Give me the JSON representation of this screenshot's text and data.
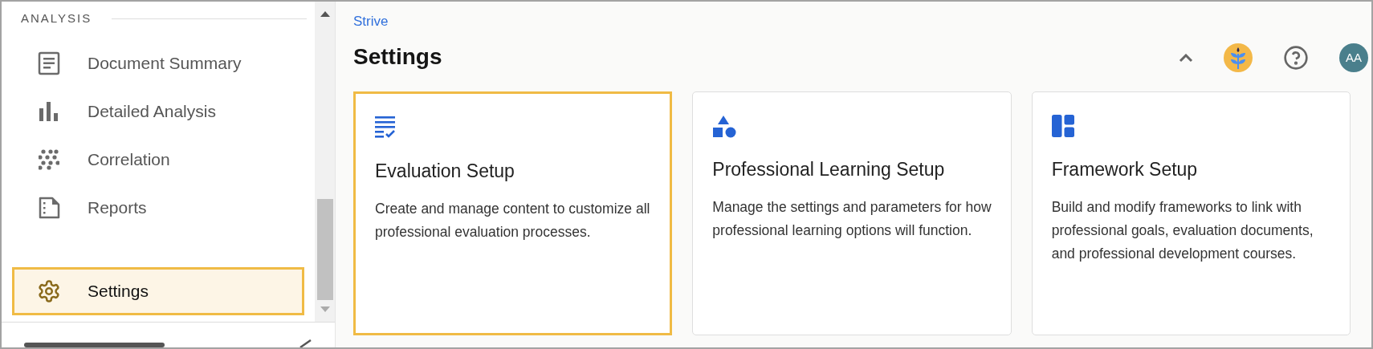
{
  "sidebar": {
    "section_title": "ANALYSIS",
    "items": [
      {
        "label": "Document Summary",
        "kind": "document",
        "selected": false
      },
      {
        "label": "Detailed Analysis",
        "kind": "bars",
        "selected": false
      },
      {
        "label": "Correlation",
        "kind": "dots",
        "selected": false
      },
      {
        "label": "Reports",
        "kind": "report",
        "selected": false
      }
    ],
    "footer_item": {
      "label": "Settings",
      "kind": "gear",
      "selected": true
    }
  },
  "header": {
    "breadcrumb": "Strive",
    "title": "Settings",
    "avatar": "AA"
  },
  "cards": [
    {
      "kind": "checklist",
      "title": "Evaluation Setup",
      "description": "Create and manage content to customize all professional evaluation processes.",
      "selected": true
    },
    {
      "kind": "shapes",
      "title": "Professional Learning Setup",
      "description": "Manage the settings and parameters for how professional learning options will function.",
      "selected": false
    },
    {
      "kind": "layout",
      "title": "Framework Setup",
      "description": "Build and modify frameworks to link with professional goals, evaluation documents, and professional development courses.",
      "selected": false
    }
  ]
}
